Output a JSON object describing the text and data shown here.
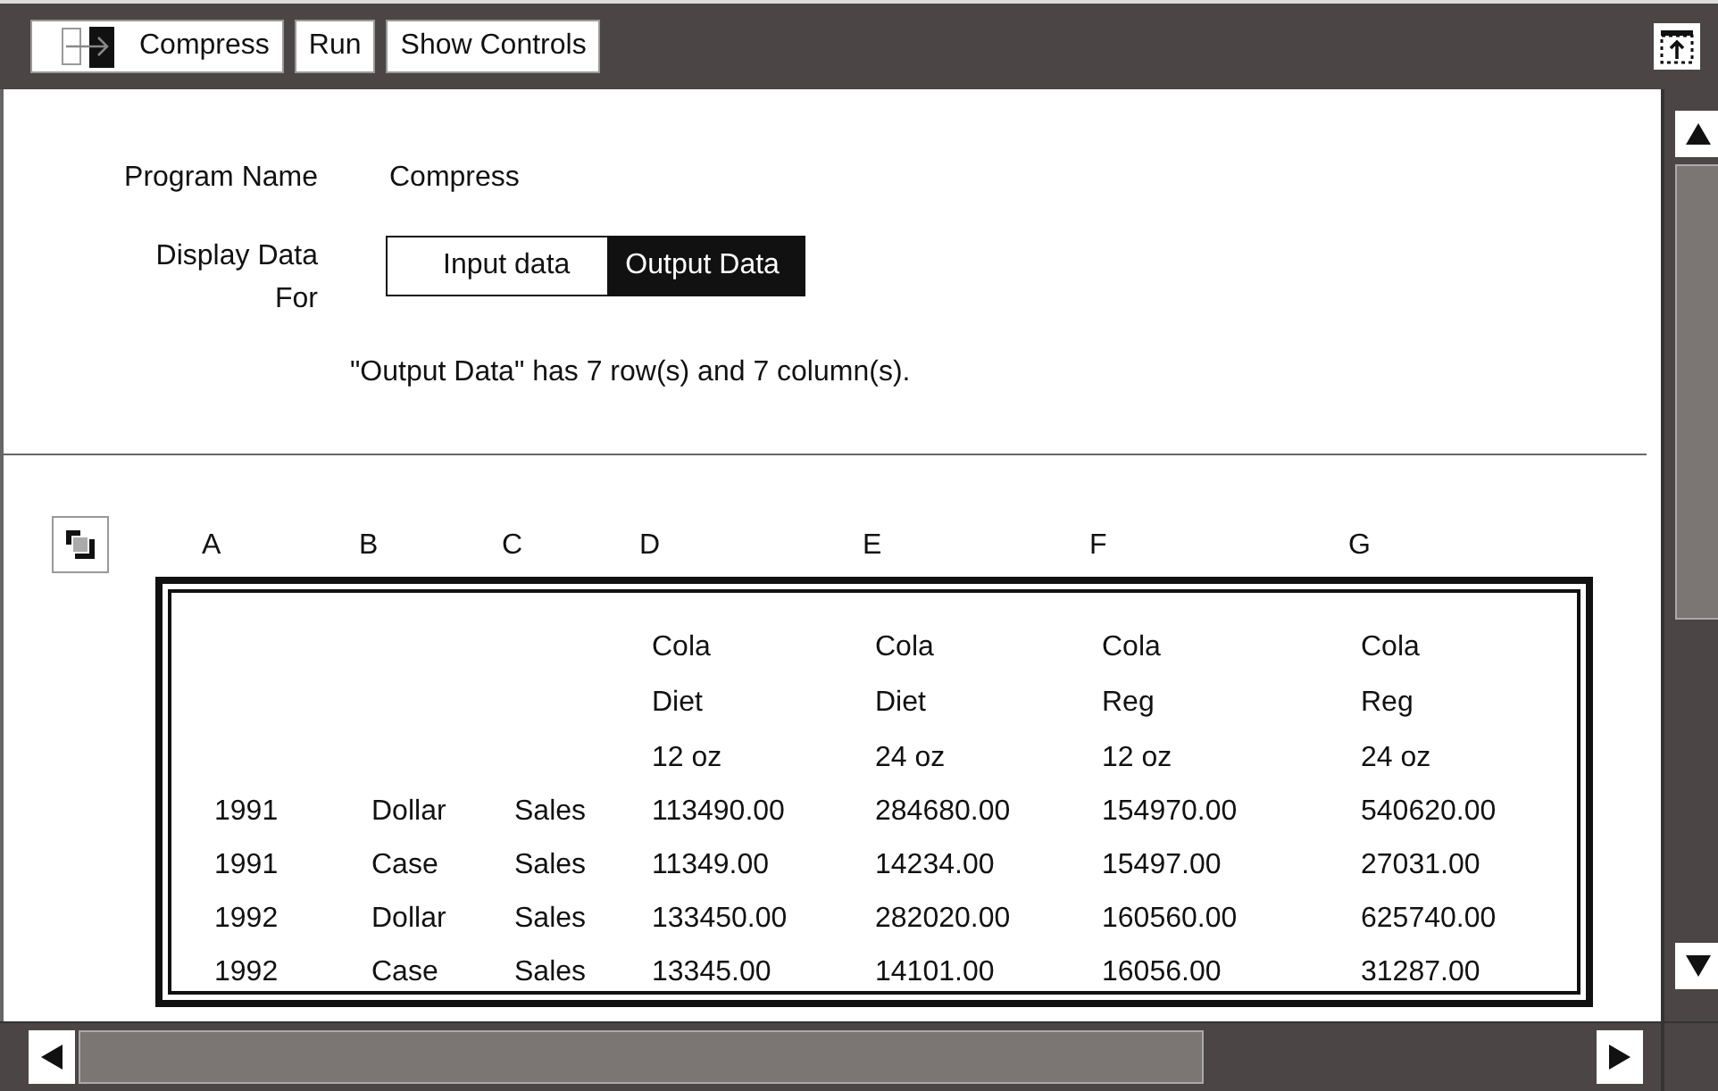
{
  "toolbar": {
    "buttons": [
      {
        "kind": "program",
        "label": "Compress"
      },
      {
        "kind": "plain",
        "label": "Run"
      },
      {
        "kind": "plain",
        "label": "Show Controls"
      }
    ]
  },
  "form": {
    "program_name": {
      "label": "Program Name",
      "value": "Compress"
    },
    "display_data": {
      "label": "Display Data For",
      "options": [
        {
          "label": "Input data",
          "selected": false
        },
        {
          "label": "Output Data",
          "selected": true
        }
      ]
    },
    "summary": "\"Output Data\" has 7 row(s) and 7 column(s)."
  },
  "table": {
    "columns": [
      "A",
      "B",
      "C",
      "D",
      "E",
      "F",
      "G"
    ],
    "header_cells": [
      {
        "lines": [
          "Cola",
          "Diet",
          "12 oz"
        ]
      },
      {
        "lines": [
          "Cola",
          "Diet",
          "24 oz"
        ]
      },
      {
        "lines": [
          "Cola",
          "Reg",
          "12 oz"
        ]
      },
      {
        "lines": [
          "Cola",
          "Reg",
          "24 oz"
        ]
      }
    ],
    "rows": [
      [
        "1991",
        "Dollar",
        "Sales",
        "113490.00",
        "284680.00",
        "154970.00",
        "540620.00"
      ],
      [
        "1991",
        "Case",
        "Sales",
        "11349.00",
        "14234.00",
        "15497.00",
        "27031.00"
      ],
      [
        "1992",
        "Dollar",
        "Sales",
        "133450.00",
        "282020.00",
        "160560.00",
        "625740.00"
      ],
      [
        "1992",
        "Case",
        "Sales",
        "13345.00",
        "14101.00",
        "16056.00",
        "31287.00"
      ]
    ]
  }
}
